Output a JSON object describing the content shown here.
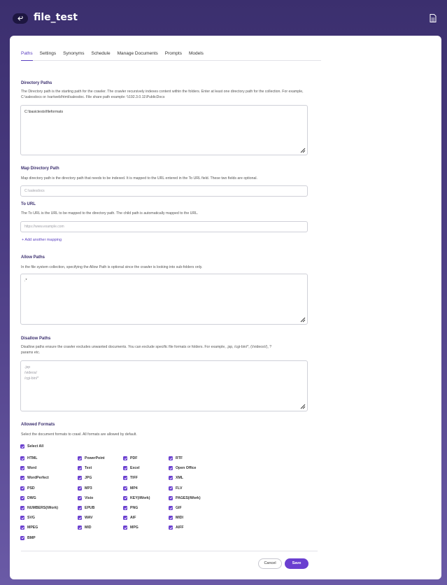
{
  "header": {
    "title": "file_test",
    "back_icon": "back-arrow-icon",
    "doc_icon": "document-icon"
  },
  "tabs": [
    {
      "label": "Paths",
      "active": true
    },
    {
      "label": "Settings"
    },
    {
      "label": "Synonyms"
    },
    {
      "label": "Schedule"
    },
    {
      "label": "Manage Documents"
    },
    {
      "label": "Prompts"
    },
    {
      "label": "Models"
    }
  ],
  "directory_paths": {
    "title": "Directory Paths",
    "description": "The Directory path is the starting path for the crawler. The crawler recursively indexes content within the folders. Enter at least one directory path for the collection. For example, C:\\salesdocs or /var/web/html/salesdoc. File share path example: \\\\192.3.0.11\\PublicDocs",
    "value": "C:\\basictests\\fileformats"
  },
  "map_directory_path": {
    "title": "Map Directory Path",
    "description": "Map directory path is the directory path that needs to be indexed. It is mapped to the URL entered in the To URL field. These two fields are optional.",
    "placeholder": "C:\\salesdocs"
  },
  "to_url": {
    "title": "To URL",
    "description": "The To URL is the URL to be mapped to the directory path. The child path is automatically mapped to the URL.",
    "placeholder": "https://www.example.com",
    "add_mapping": "+ Add another mapping"
  },
  "allow_paths": {
    "title": "Allow Paths",
    "description": "In the file system collection, specifying the Allow Path is optional since the crawler is looking into sub-folders only.",
    "value": ".*"
  },
  "disallow_paths": {
    "title": "Disallow Paths",
    "description_line1": "Disallow paths ensure the crawler excludes unwanted documents. You can exclude specific file formats or folders. For example, .jsp, /cgi-bin/*, (\\/videos\\/), ?",
    "description_line2": "params etc.",
    "placeholder_lines": [
      ".jsp",
      "/videos/",
      "/cgi-bin/*"
    ]
  },
  "allowed_formats": {
    "title": "Allowed Formats",
    "description": "Select the document formats to crawl. All formats are allowed by default.",
    "select_all": "Select All",
    "formats": [
      "HTML",
      "PowerPoint",
      "PDF",
      "RTF",
      "Word",
      "Text",
      "Excel",
      "Open Office",
      "WordPerfect",
      "JPG",
      "TIFF",
      "XML",
      "PSD",
      "MP3",
      "MP4",
      "FLV",
      "DWG",
      "Visio",
      "KEY(iWork)",
      "PAGES(iWork)",
      "NUMBERS(iWork)",
      "EPUB",
      "PNG",
      "GIF",
      "SVG",
      "WAV",
      "AIF",
      "MIDI",
      "MPEG",
      "MID",
      "MPG",
      "AIFF",
      "BMP"
    ]
  },
  "actions": {
    "cancel": "Cancel",
    "save": "Save"
  },
  "colors": {
    "accent": "#6a3fd0",
    "header_bg": "#3b2f6e"
  }
}
